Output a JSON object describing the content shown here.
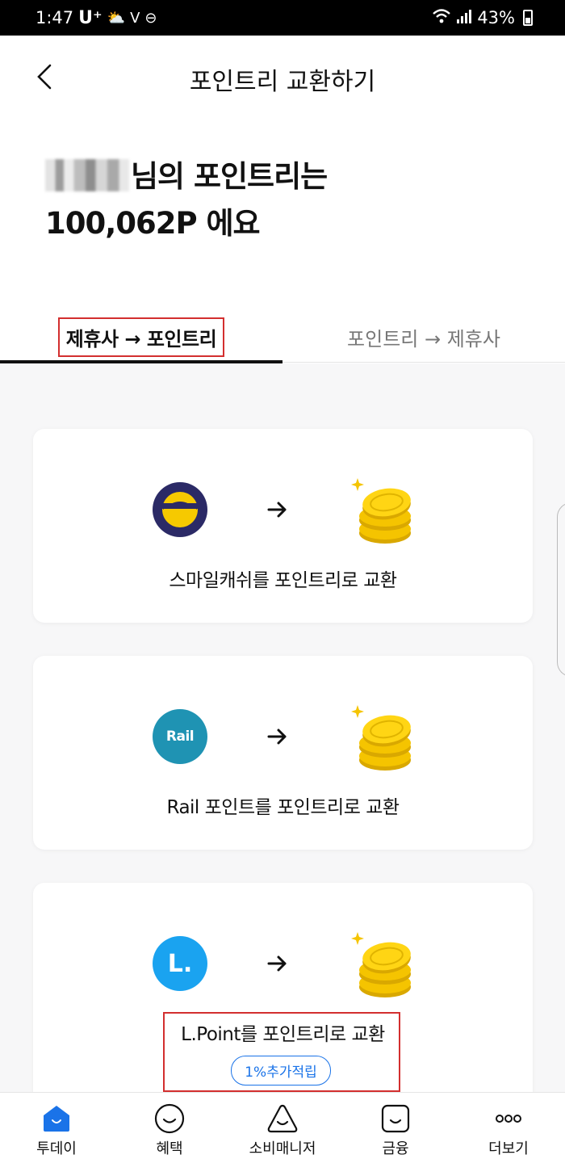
{
  "status_bar": {
    "time": "1:47",
    "carrier": "U⁺",
    "battery": "43%"
  },
  "header": {
    "title": "포인트리 교환하기"
  },
  "summary": {
    "line1_suffix": "님의 포인트리는",
    "line2": "100,062P 에요"
  },
  "tabs": [
    {
      "label": "제휴사 → 포인트리",
      "active": true
    },
    {
      "label": "포인트리 → 제휴사",
      "active": false
    }
  ],
  "cards": [
    {
      "partner_icon": "smile-cash-logo",
      "label": "스마일캐쉬를 포인트리로 교환"
    },
    {
      "partner_icon": "rail-point-logo",
      "logo_text": "Rail",
      "label": "Rail 포인트를 포인트리로 교환"
    },
    {
      "partner_icon": "lpoint-logo",
      "logo_text": "L.",
      "label": "L.Point를 포인트리로 교환",
      "badge": "1%추가적립"
    }
  ],
  "bottom_nav": [
    {
      "label": "투데이",
      "icon": "home-icon",
      "active": true
    },
    {
      "label": "혜택",
      "icon": "smile-icon"
    },
    {
      "label": "소비매니저",
      "icon": "triangle-smile-icon"
    },
    {
      "label": "금융",
      "icon": "wallet-icon"
    },
    {
      "label": "더보기",
      "icon": "more-icon"
    }
  ],
  "colors": {
    "accent_blue": "#1a73e8",
    "highlight_red": "#d32f2f",
    "coin_gold": "#f5c400",
    "smile_navy": "#2b2a66",
    "rail_teal": "#1f93b3",
    "lpoint_blue": "#1aa3f0"
  }
}
